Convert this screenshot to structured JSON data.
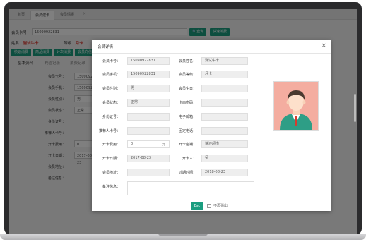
{
  "colors": {
    "accent": "#1a9d7f",
    "danger": "#d9342b",
    "avatar_bg": "#f4ada0"
  },
  "tabs": [
    {
      "label": "首页"
    },
    {
      "label": "会员建卡"
    },
    {
      "label": "会员情报"
    }
  ],
  "search": {
    "card_label": "会员卡号",
    "card_value": "15090922831",
    "query_button": "查询",
    "quick_button": "快速消费"
  },
  "member_bar": {
    "name_label": "姓名：",
    "name_value": "测试牛卡",
    "level_label": "等级：",
    "level_value": "月卡"
  },
  "actions": [
    "快速消费",
    "商品消费",
    "计次消费",
    "会员充值"
  ],
  "subtabs": [
    "基本资料",
    "充值记录",
    "消费记录"
  ],
  "bg_form": {
    "labels": [
      "会员卡号：",
      "会员手机：",
      "会员性别：",
      "会员状态：",
      "身份证号：",
      "推荐人卡号：",
      "开卡费用：",
      "开卡日期：",
      "会员地址：",
      "备注信息："
    ],
    "values": [
      "15090922831",
      "15090922831",
      "男",
      "正常",
      "",
      "",
      "0",
      "2017-08-23",
      "",
      ""
    ]
  },
  "modal": {
    "title": "会员详情",
    "close": "×",
    "fields": {
      "card_no_label": "会员卡号：",
      "card_no": "15090922831",
      "name_label": "会员姓名：",
      "name": "测试牛卡",
      "phone_label": "会员手机：",
      "phone": "15090922831",
      "level_label": "会员等级：",
      "level": "月卡",
      "gender_label": "会员性别：",
      "gender": "男",
      "birthday_label": "会员生日：",
      "birthday": "",
      "status_label": "会员状态：",
      "status": "正常",
      "password_label": "卡面密码：",
      "password": "",
      "idcard_label": "身份证号：",
      "idcard": "",
      "email_label": "电子邮箱：",
      "email": "",
      "referrer_label": "推荐人卡号：",
      "referrer": "",
      "tel_label": "固定电话：",
      "tel": "",
      "fee_label": "开卡费用：",
      "fee": "0",
      "fee_unit": "元",
      "store_label": "开卡店铺：",
      "store": "快还超市",
      "open_date_label": "开卡日期：",
      "open_date": "2017-08-23",
      "opener_label": "开卡人：",
      "opener": "吴",
      "address_label": "会员地址：",
      "address": "",
      "expire_label": "过期时间：",
      "expire": "2018-08-23",
      "remark_label": "备注信息：",
      "remark": ""
    },
    "esc_label": "Esc",
    "nopopup_label": "不再弹出"
  }
}
